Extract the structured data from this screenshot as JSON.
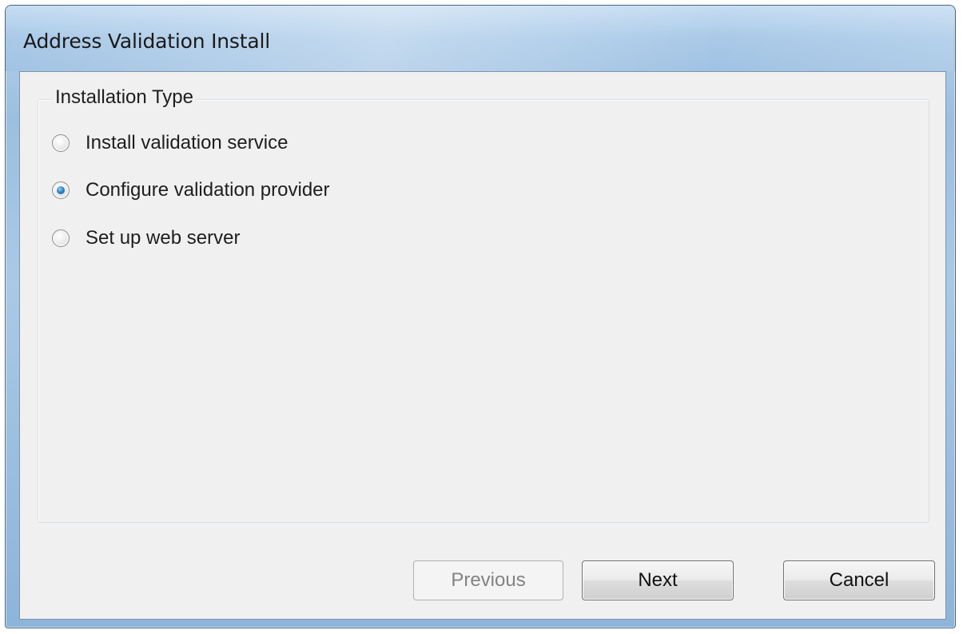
{
  "window": {
    "title": "Address Validation Install"
  },
  "group": {
    "legend": "Installation Type",
    "options": [
      {
        "label": "Install validation service",
        "checked": false
      },
      {
        "label": "Configure validation provider",
        "checked": true
      },
      {
        "label": "Set up web server",
        "checked": false
      }
    ]
  },
  "buttons": {
    "previous": {
      "label": "Previous",
      "enabled": false
    },
    "next": {
      "label": "Next",
      "enabled": true
    },
    "cancel": {
      "label": "Cancel",
      "enabled": true
    }
  },
  "colors": {
    "titlebar": "#a4c6e6",
    "client_bg": "#f0f0f0",
    "radio_selected": "#2f86c8"
  }
}
